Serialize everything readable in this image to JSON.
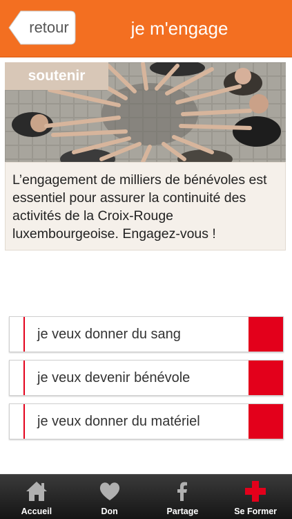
{
  "header": {
    "back_label": "retour",
    "title": "je m'engage",
    "background_color": "#f36f21"
  },
  "hero": {
    "tag_label": "soutenir",
    "image_description_icon": "volunteers-circle-photo"
  },
  "description": {
    "text": "L’engagement de milliers de bénévoles est essentiel pour assurer la continuité des activités de la Croix-Rouge luxembourgeoise. Engagez-vous !"
  },
  "actions": [
    {
      "label": "je veux donner du sang"
    },
    {
      "label": "je veux devenir bénévole"
    },
    {
      "label": "je veux donner du matériel"
    }
  ],
  "accent_color": "#e3001b",
  "tabbar": {
    "tabs": [
      {
        "label": "Accueil",
        "icon": "home-icon"
      },
      {
        "label": "Don",
        "icon": "heart-icon"
      },
      {
        "label": "Partage",
        "icon": "facebook-icon"
      },
      {
        "label": "Se Former",
        "icon": "red-cross-icon"
      }
    ]
  }
}
